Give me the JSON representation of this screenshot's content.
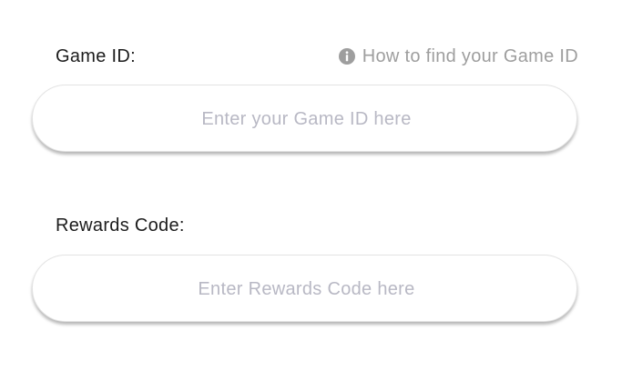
{
  "game_id": {
    "label": "Game ID:",
    "help_text": "How to find your Game ID",
    "help_icon": "info-icon",
    "placeholder": "Enter your Game ID here",
    "value": ""
  },
  "rewards_code": {
    "label": "Rewards Code:",
    "placeholder": "Enter Rewards Code here",
    "value": ""
  },
  "colors": {
    "label_text": "#1c1c1c",
    "help_text": "#9e9e9e",
    "placeholder_text": "#b8b8c4",
    "input_border": "#e3e3e3"
  }
}
